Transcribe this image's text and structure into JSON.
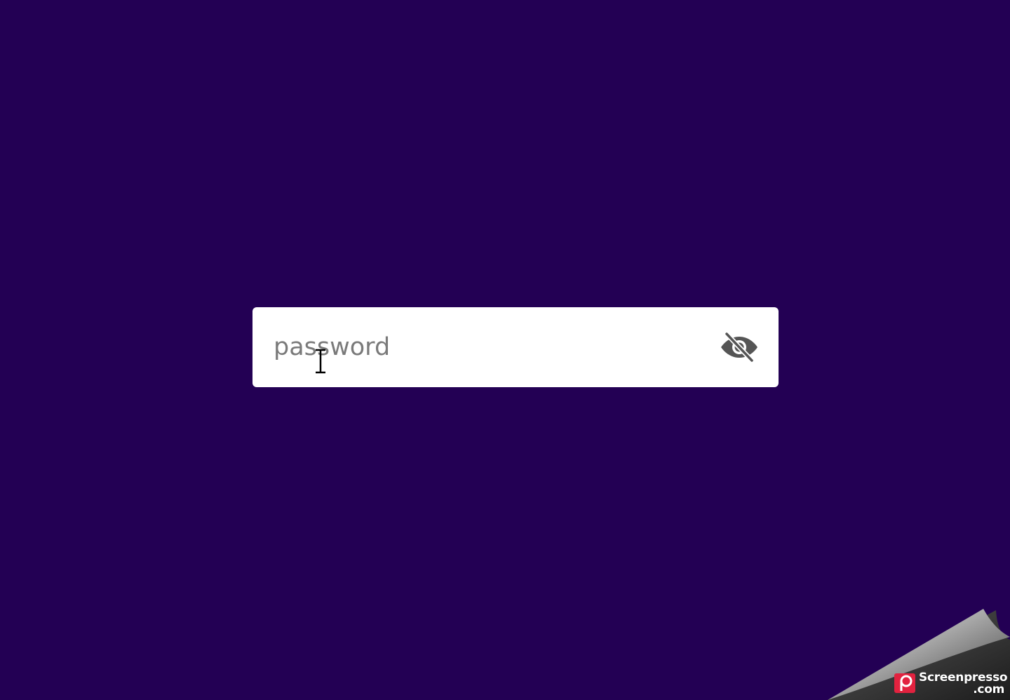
{
  "password_field": {
    "placeholder": "password",
    "value": "",
    "toggle_icon": "eye-slash-icon"
  },
  "watermark": {
    "brand_line1": "Screenpresso",
    "brand_line2": ".com",
    "logo_icon": "screenpresso-logo"
  },
  "colors": {
    "background": "#230054",
    "field_background": "#ffffff",
    "placeholder": "#7a7a7a",
    "icon": "#555555",
    "logo": "#e2223f"
  }
}
